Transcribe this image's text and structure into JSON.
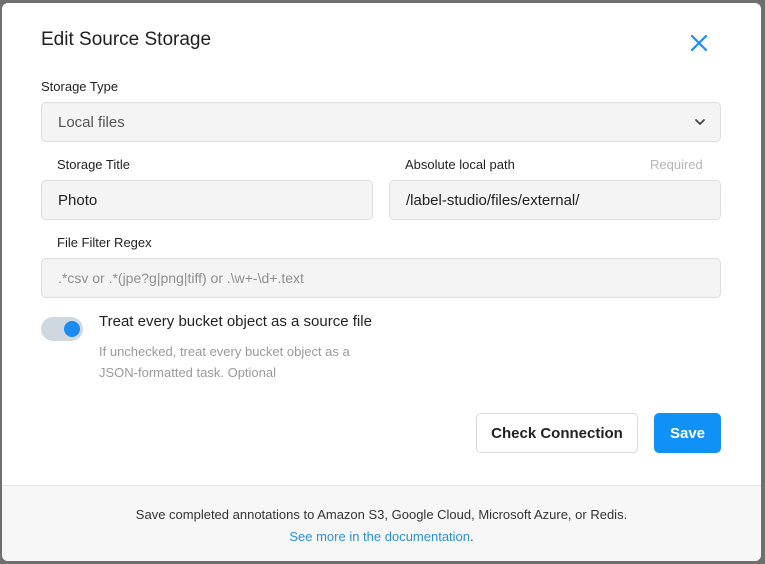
{
  "dialog": {
    "title": "Edit Source Storage",
    "close_icon": "close-icon"
  },
  "storage_type": {
    "label": "Storage Type",
    "value": "Local files",
    "icon": "chevron-down-icon"
  },
  "storage_title": {
    "label": "Storage Title",
    "value": "Photo"
  },
  "local_path": {
    "label": "Absolute local path",
    "required": "Required",
    "value": "/label-studio/files/external/"
  },
  "file_filter": {
    "label": "File Filter Regex",
    "placeholder": ".*csv or .*(jpe?g|png|tiff) or .\\w+-\\d+.text"
  },
  "treat_as_source": {
    "label": "Treat every bucket object as a source file",
    "help": "If unchecked, treat every bucket object as a JSON-formatted task. Optional",
    "checked": true
  },
  "buttons": {
    "check_connection": "Check Connection",
    "save": "Save"
  },
  "footer": {
    "text": "Save completed annotations to Amazon S3, Google Cloud, Microsoft Azure, or Redis.",
    "link": "See more in the documentation",
    "link_suffix": "."
  },
  "colors": {
    "accent": "#0f91f5",
    "link": "#2b8de0"
  }
}
